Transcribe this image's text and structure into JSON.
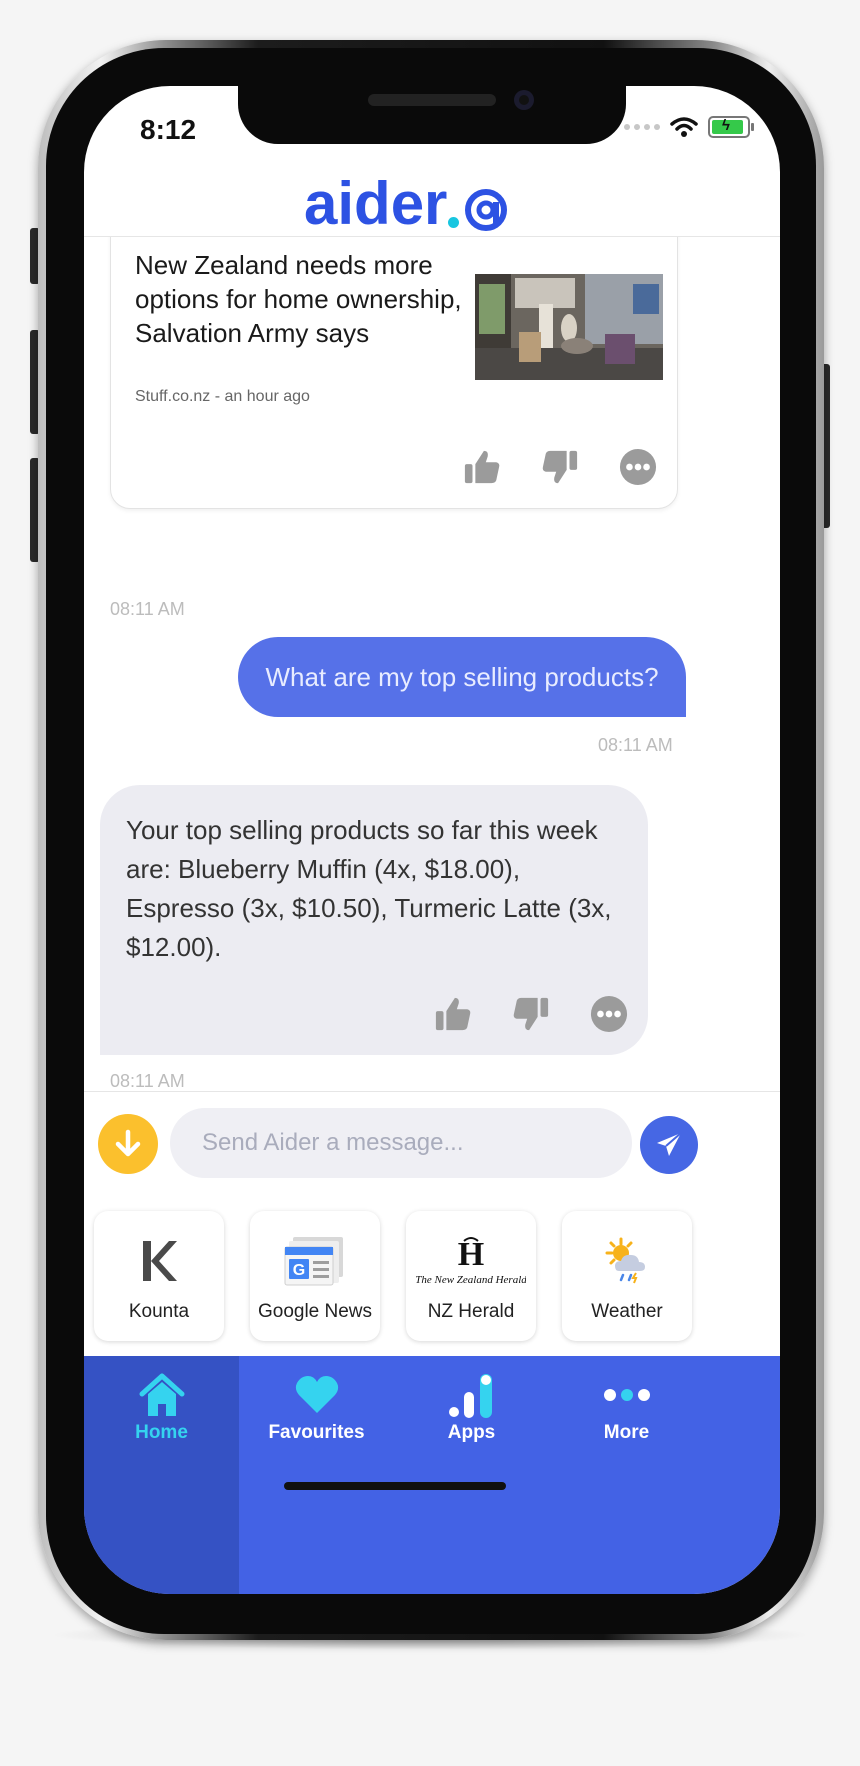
{
  "status_bar": {
    "time": "8:12"
  },
  "header": {
    "logo_text": "aider",
    "brand_color": "#2d52e3",
    "accent_color": "#18c6e0"
  },
  "news_card": {
    "title": "New Zealand needs more options for home ownership, Salvation Army says",
    "source": "Stuff.co.nz - an hour ago",
    "timestamp": "08:11 AM"
  },
  "user_message": {
    "text": "What are my top selling products?",
    "timestamp": "08:11 AM"
  },
  "bot_message": {
    "text": "Your top selling products so far this week are: Blueberry Muffin (4x, $18.00), Espresso (3x, $10.50), Turmeric Latte (3x, $12.00).",
    "timestamp": "08:11 AM"
  },
  "composer": {
    "placeholder": "Send Aider a message..."
  },
  "apps": [
    {
      "label": "Kounta",
      "icon": "kounta-logo"
    },
    {
      "label": "Google News",
      "icon": "google-news-logo"
    },
    {
      "label": "NZ Herald",
      "icon": "nz-herald-logo",
      "logo_text": "The New Zealand Herald"
    },
    {
      "label": "Weather",
      "icon": "weather-icon"
    }
  ],
  "tabs": [
    {
      "label": "Home",
      "icon": "home-icon",
      "active": true
    },
    {
      "label": "Favourites",
      "icon": "heart-icon",
      "active": false
    },
    {
      "label": "Apps",
      "icon": "apps-icon",
      "active": false
    },
    {
      "label": "More",
      "icon": "more-icon",
      "active": false
    }
  ],
  "colors": {
    "tab_bar": "#4362e5",
    "tab_active": "#3552c4",
    "active_label": "#35d3ef",
    "user_bubble": "#5671e8",
    "bot_bubble": "#ececf2",
    "scroll_button": "#fbc02d"
  }
}
